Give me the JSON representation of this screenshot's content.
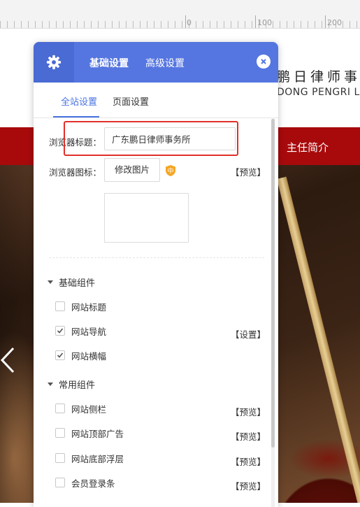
{
  "ruler": {
    "labels": [
      "0",
      "100",
      "200"
    ]
  },
  "site": {
    "name_cn": "鹏日律师事",
    "name_en": "DONG PENGRI LA",
    "nav_item": "主任简介"
  },
  "panel": {
    "header_tabs": [
      "基础设置",
      "高级设置"
    ],
    "active_header_tab": "基础设置",
    "sub_tabs": [
      "全站设置",
      "页面设置"
    ],
    "active_sub_tab": "全站设置",
    "browser_title_label": "浏览器标题：",
    "browser_title_value": "广东鹏日律师事务所",
    "browser_icon_label": "浏览器图标：",
    "change_image_button": "修改图片",
    "badge_char": "中",
    "preview_link": "【预览】",
    "settings_link": "【设置】",
    "section_basic": "基础组件",
    "section_common": "常用组件",
    "basic_items": [
      {
        "label": "网站标题",
        "checked": false,
        "action": ""
      },
      {
        "label": "网站导航",
        "checked": true,
        "action": "【设置】"
      },
      {
        "label": "网站横幅",
        "checked": true,
        "action": ""
      }
    ],
    "common_items": [
      {
        "label": "网站侧栏",
        "checked": false,
        "action": "【预览】"
      },
      {
        "label": "网站顶部广告",
        "checked": false,
        "action": "【预览】"
      },
      {
        "label": "网站底部浮层",
        "checked": false,
        "action": "【预览】"
      },
      {
        "label": "会员登录条",
        "checked": false,
        "action": "【预览】"
      }
    ]
  },
  "colors": {
    "panel_header": "#5576e0",
    "accent": "#4a74e0",
    "nav_red": "#a80a0c",
    "highlight": "#e0312a",
    "badge": "#f5a623"
  }
}
